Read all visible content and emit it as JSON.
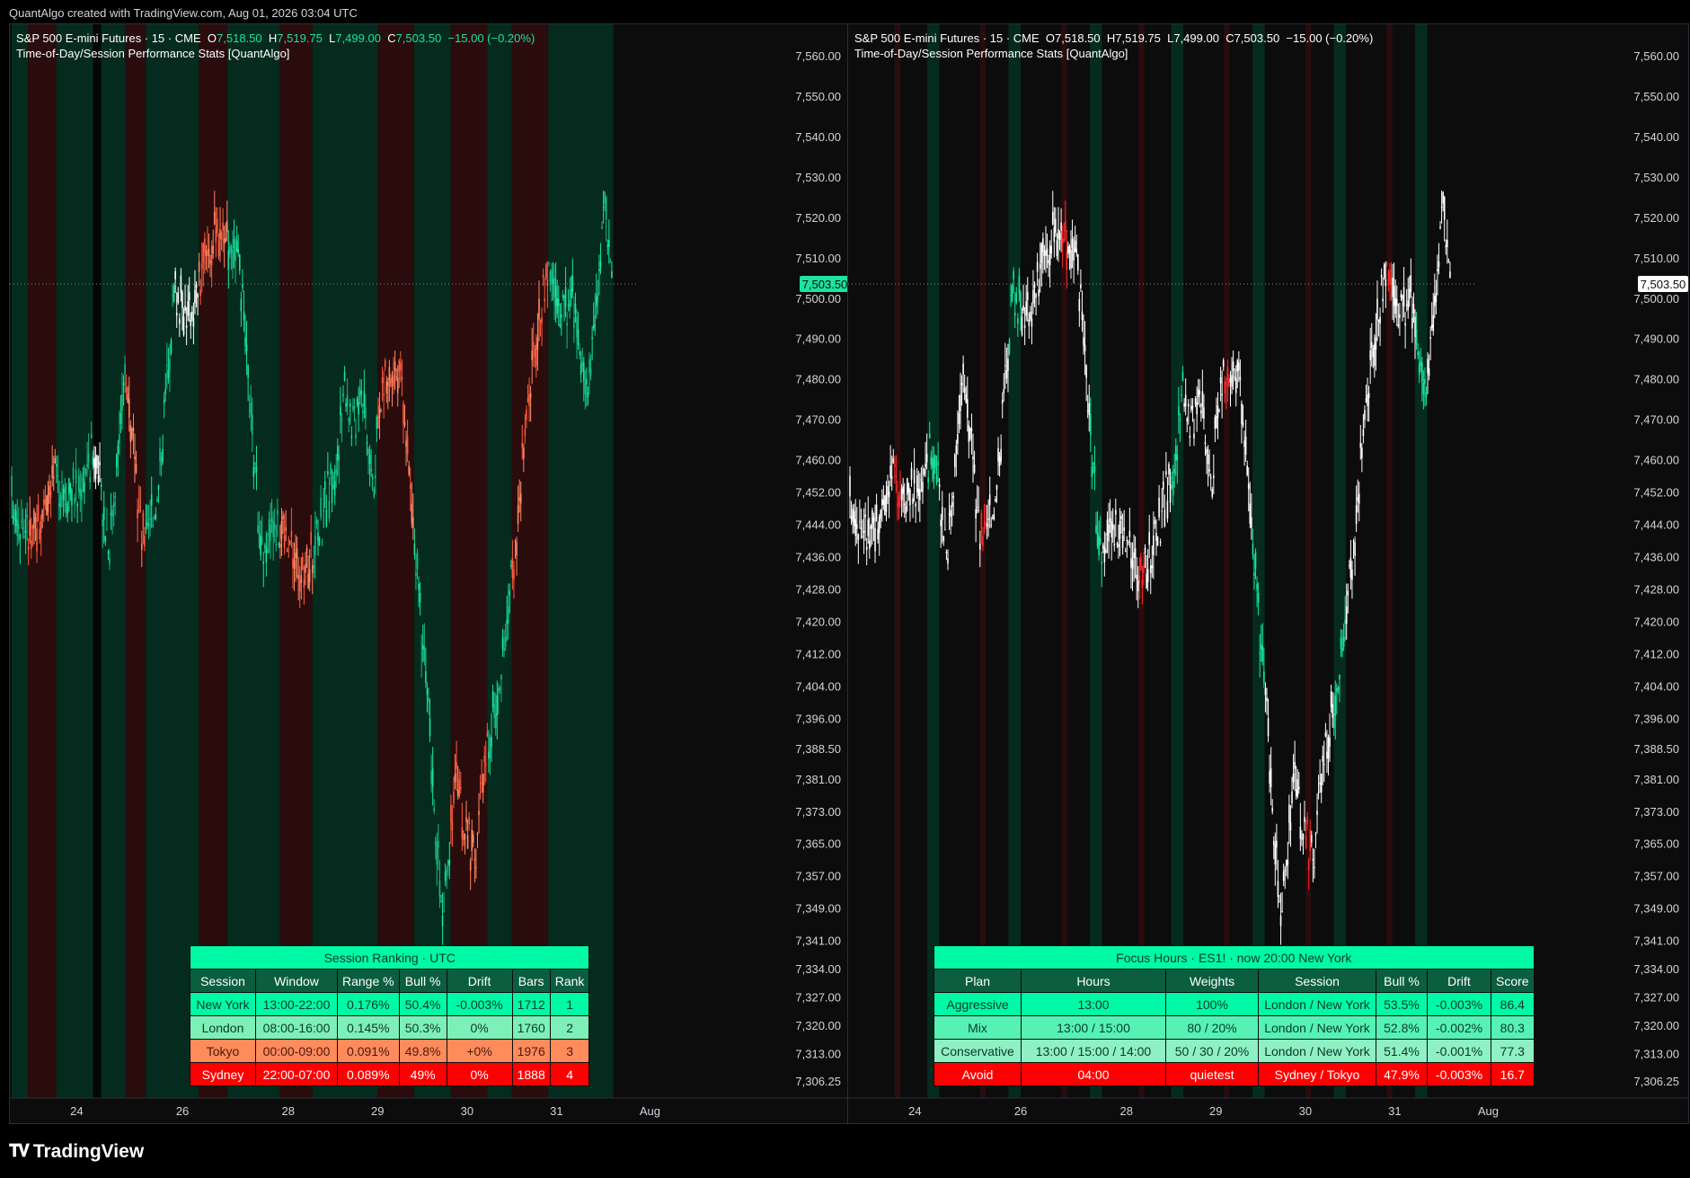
{
  "credit": "QuantAlgo created with TradingView.com, Aug 01, 2026 03:04 UTC",
  "brand": "TradingView",
  "colors": {
    "bull_green": "#1be3a0",
    "bull_light": "#7df0c6",
    "bear_orange": "#ff8a65",
    "bear_red": "#ff1a1a",
    "neutral_white": "#ffffff",
    "band_green": "#042b1e",
    "band_red": "#2a0c0c",
    "table_title": "#00f9a6",
    "table_header": "#0b5e40"
  },
  "panes": [
    {
      "symbol": "S&P 500 E-mini Futures · 15 · CME",
      "o_label": "O",
      "o": "7,518.50",
      "h_label": "H",
      "h": "7,519.75",
      "l_label": "L",
      "l": "7,499.00",
      "c_label": "C",
      "c": "7,503.50",
      "change": "−15.00 (−0.20%)",
      "indicator": "Time-of-Day/Session Performance Stats [QuantAlgo]",
      "last_price": "7,503.50"
    },
    {
      "symbol": "S&P 500 E-mini Futures · 15 · CME",
      "o_label": "O",
      "o": "7,518.50",
      "h_label": "H",
      "h": "7,519.75",
      "l_label": "L",
      "l": "7,499.00",
      "c_label": "C",
      "c": "7,503.50",
      "change": "−15.00 (−0.20%)",
      "indicator": "Time-of-Day/Session Performance Stats [QuantAlgo]",
      "last_price": "7,503.50"
    }
  ],
  "session_table": {
    "title": "Session Ranking  ·  UTC",
    "headers": [
      "Session",
      "Window",
      "Range %",
      "Bull %",
      "Drift",
      "Bars",
      "Rank"
    ],
    "rows": [
      {
        "cells": [
          "New York",
          "13:00-22:00",
          "0.176%",
          "50.4%",
          "-0.003%",
          "1712",
          "1"
        ],
        "bg": "#00f9a6",
        "fg": "#0a3a2a"
      },
      {
        "cells": [
          "London",
          "08:00-16:00",
          "0.145%",
          "50.3%",
          "0%",
          "1760",
          "2"
        ],
        "bg": "#7df0b8",
        "fg": "#0a3a2a"
      },
      {
        "cells": [
          "Tokyo",
          "00:00-09:00",
          "0.091%",
          "49.8%",
          "+0%",
          "1976",
          "3"
        ],
        "bg": "#ff8a5c",
        "fg": "#4a1a0a"
      },
      {
        "cells": [
          "Sydney",
          "22:00-07:00",
          "0.089%",
          "49%",
          "0%",
          "1888",
          "4"
        ],
        "bg": "#ff0000",
        "fg": "#ffffff"
      }
    ]
  },
  "focus_table": {
    "title": "Focus Hours  ·  ES1!  ·  now 20:00  New York",
    "headers": [
      "Plan",
      "Hours",
      "Weights",
      "Session",
      "Bull %",
      "Drift",
      "Score"
    ],
    "rows": [
      {
        "cells": [
          "Aggressive",
          "13:00",
          "100%",
          "London / New York",
          "53.5%",
          "-0.003%",
          "86.4"
        ],
        "bg": "#00f9a6",
        "fg": "#0a3a2a"
      },
      {
        "cells": [
          "Mix",
          "13:00  /  15:00",
          "80 / 20%",
          "London / New York",
          "52.8%",
          "-0.002%",
          "80.3"
        ],
        "bg": "#55f2b4",
        "fg": "#0a3a2a"
      },
      {
        "cells": [
          "Conservative",
          "13:00  /  15:00  /  14:00",
          "50 / 30 / 20%",
          "London / New York",
          "51.4%",
          "-0.001%",
          "77.3"
        ],
        "bg": "#8ff0c4",
        "fg": "#0a3a2a"
      },
      {
        "cells": [
          "Avoid",
          "04:00",
          "quietest",
          "Sydney / Tokyo",
          "47.9%",
          "-0.003%",
          "16.7"
        ],
        "bg": "#ff0000",
        "fg": "#ffffff"
      }
    ]
  },
  "chart_data": [
    {
      "type": "candlestick",
      "title": "S&P 500 E-mini Futures · 15 · CME",
      "timeframe": "15",
      "ylim": [
        7302,
        7566
      ],
      "y_ticks": [
        "7,560.00",
        "7,550.00",
        "7,540.00",
        "7,530.00",
        "7,520.00",
        "7,510.00",
        "7,500.00",
        "7,490.00",
        "7,480.00",
        "7,470.00",
        "7,460.00",
        "7,452.00",
        "7,444.00",
        "7,436.00",
        "7,428.00",
        "7,420.00",
        "7,412.00",
        "7,404.00",
        "7,396.00",
        "7,388.50",
        "7,381.00",
        "7,373.00",
        "7,365.00",
        "7,357.00",
        "7,349.00",
        "7,341.00",
        "7,334.00",
        "7,327.00",
        "7,320.00",
        "7,313.00",
        "7,306.25"
      ],
      "x_ticks": [
        "24",
        "26",
        "28",
        "29",
        "30",
        "31",
        "Aug"
      ],
      "x_tick_day_index": [
        0.8,
        2.1,
        3.4,
        4.5,
        5.6,
        6.7,
        7.85
      ],
      "last_price": 7503.5,
      "price_path": [
        [
          0,
          7450
        ],
        [
          0.25,
          7440
        ],
        [
          0.5,
          7455
        ],
        [
          0.8,
          7452
        ],
        [
          1.0,
          7462
        ],
        [
          1.2,
          7440
        ],
        [
          1.4,
          7482
        ],
        [
          1.6,
          7440
        ],
        [
          1.8,
          7452
        ],
        [
          2.0,
          7502
        ],
        [
          2.2,
          7495
        ],
        [
          2.4,
          7512
        ],
        [
          2.6,
          7518
        ],
        [
          2.8,
          7506
        ],
        [
          3.0,
          7455
        ],
        [
          3.1,
          7432
        ],
        [
          3.2,
          7447
        ],
        [
          3.4,
          7440
        ],
        [
          3.6,
          7430
        ],
        [
          3.8,
          7445
        ],
        [
          4.0,
          7458
        ],
        [
          4.1,
          7480
        ],
        [
          4.2,
          7468
        ],
        [
          4.3,
          7480
        ],
        [
          4.45,
          7455
        ],
        [
          4.55,
          7477
        ],
        [
          4.7,
          7483
        ],
        [
          4.8,
          7478
        ],
        [
          4.95,
          7440
        ],
        [
          5.1,
          7405
        ],
        [
          5.2,
          7372
        ],
        [
          5.3,
          7345
        ],
        [
          5.45,
          7382
        ],
        [
          5.55,
          7370
        ],
        [
          5.7,
          7362
        ],
        [
          5.85,
          7390
        ],
        [
          6.0,
          7404
        ],
        [
          6.2,
          7440
        ],
        [
          6.35,
          7475
        ],
        [
          6.5,
          7495
        ],
        [
          6.6,
          7506
        ],
        [
          6.75,
          7497
        ],
        [
          6.9,
          7500
        ],
        [
          7.05,
          7475
        ],
        [
          7.2,
          7500
        ],
        [
          7.3,
          7525
        ],
        [
          7.38,
          7503.5
        ]
      ],
      "session_bands": [
        {
          "from": 0.0,
          "to": 0.2,
          "kind": "green"
        },
        {
          "from": 0.2,
          "to": 0.55,
          "kind": "red"
        },
        {
          "from": 0.55,
          "to": 1.0,
          "kind": "green"
        },
        {
          "from": 1.0,
          "to": 1.1,
          "kind": "dark"
        },
        {
          "from": 1.1,
          "to": 1.4,
          "kind": "green"
        },
        {
          "from": 1.4,
          "to": 1.65,
          "kind": "red"
        },
        {
          "from": 1.65,
          "to": 2.3,
          "kind": "green"
        },
        {
          "from": 2.3,
          "to": 2.65,
          "kind": "red"
        },
        {
          "from": 2.65,
          "to": 3.3,
          "kind": "green"
        },
        {
          "from": 3.3,
          "to": 3.7,
          "kind": "red"
        },
        {
          "from": 3.7,
          "to": 4.5,
          "kind": "green"
        },
        {
          "from": 4.5,
          "to": 4.95,
          "kind": "red"
        },
        {
          "from": 4.95,
          "to": 5.4,
          "kind": "green"
        },
        {
          "from": 5.4,
          "to": 5.85,
          "kind": "red"
        },
        {
          "from": 5.85,
          "to": 6.15,
          "kind": "green"
        },
        {
          "from": 6.15,
          "to": 6.6,
          "kind": "red"
        },
        {
          "from": 6.6,
          "to": 7.4,
          "kind": "green"
        }
      ],
      "candle_color_mode": "session"
    },
    {
      "type": "candlestick",
      "title": "S&P 500 E-mini Futures · 15 · CME",
      "timeframe": "15",
      "ylim": [
        7302,
        7566
      ],
      "y_ticks": [
        "7,560.00",
        "7,550.00",
        "7,540.00",
        "7,530.00",
        "7,520.00",
        "7,510.00",
        "7,500.00",
        "7,490.00",
        "7,480.00",
        "7,470.00",
        "7,460.00",
        "7,452.00",
        "7,444.00",
        "7,436.00",
        "7,428.00",
        "7,420.00",
        "7,412.00",
        "7,404.00",
        "7,396.00",
        "7,388.50",
        "7,381.00",
        "7,373.00",
        "7,365.00",
        "7,357.00",
        "7,349.00",
        "7,341.00",
        "7,334.00",
        "7,327.00",
        "7,320.00",
        "7,313.00",
        "7,306.25"
      ],
      "x_ticks": [
        "24",
        "26",
        "28",
        "29",
        "30",
        "31",
        "Aug"
      ],
      "x_tick_day_index": [
        0.8,
        2.1,
        3.4,
        4.5,
        5.6,
        6.7,
        7.85
      ],
      "last_price": 7503.5,
      "price_path": [
        [
          0,
          7450
        ],
        [
          0.25,
          7440
        ],
        [
          0.5,
          7455
        ],
        [
          0.8,
          7452
        ],
        [
          1.0,
          7462
        ],
        [
          1.2,
          7440
        ],
        [
          1.4,
          7482
        ],
        [
          1.6,
          7440
        ],
        [
          1.8,
          7452
        ],
        [
          2.0,
          7502
        ],
        [
          2.2,
          7495
        ],
        [
          2.4,
          7512
        ],
        [
          2.6,
          7518
        ],
        [
          2.8,
          7506
        ],
        [
          3.0,
          7455
        ],
        [
          3.1,
          7432
        ],
        [
          3.2,
          7447
        ],
        [
          3.4,
          7440
        ],
        [
          3.6,
          7430
        ],
        [
          3.8,
          7445
        ],
        [
          4.0,
          7458
        ],
        [
          4.1,
          7480
        ],
        [
          4.2,
          7468
        ],
        [
          4.3,
          7480
        ],
        [
          4.45,
          7455
        ],
        [
          4.55,
          7477
        ],
        [
          4.7,
          7483
        ],
        [
          4.8,
          7478
        ],
        [
          4.95,
          7440
        ],
        [
          5.1,
          7405
        ],
        [
          5.2,
          7372
        ],
        [
          5.3,
          7345
        ],
        [
          5.45,
          7382
        ],
        [
          5.55,
          7370
        ],
        [
          5.7,
          7362
        ],
        [
          5.85,
          7390
        ],
        [
          6.0,
          7404
        ],
        [
          6.2,
          7440
        ],
        [
          6.35,
          7475
        ],
        [
          6.5,
          7495
        ],
        [
          6.6,
          7506
        ],
        [
          6.75,
          7497
        ],
        [
          6.9,
          7500
        ],
        [
          7.05,
          7475
        ],
        [
          7.2,
          7500
        ],
        [
          7.3,
          7525
        ],
        [
          7.38,
          7503.5
        ]
      ],
      "session_bands": [
        {
          "from": 0.55,
          "to": 0.62,
          "kind": "red"
        },
        {
          "from": 0.95,
          "to": 1.1,
          "kind": "green"
        },
        {
          "from": 1.6,
          "to": 1.67,
          "kind": "red"
        },
        {
          "from": 1.95,
          "to": 2.1,
          "kind": "green"
        },
        {
          "from": 2.6,
          "to": 2.67,
          "kind": "red"
        },
        {
          "from": 2.95,
          "to": 3.1,
          "kind": "green"
        },
        {
          "from": 3.55,
          "to": 3.62,
          "kind": "red"
        },
        {
          "from": 3.95,
          "to": 4.1,
          "kind": "green"
        },
        {
          "from": 4.6,
          "to": 4.67,
          "kind": "red"
        },
        {
          "from": 4.95,
          "to": 5.1,
          "kind": "green"
        },
        {
          "from": 5.6,
          "to": 5.67,
          "kind": "red"
        },
        {
          "from": 5.95,
          "to": 6.1,
          "kind": "green"
        },
        {
          "from": 6.6,
          "to": 6.67,
          "kind": "red"
        },
        {
          "from": 6.95,
          "to": 7.1,
          "kind": "green"
        }
      ],
      "candle_color_mode": "focus"
    }
  ]
}
